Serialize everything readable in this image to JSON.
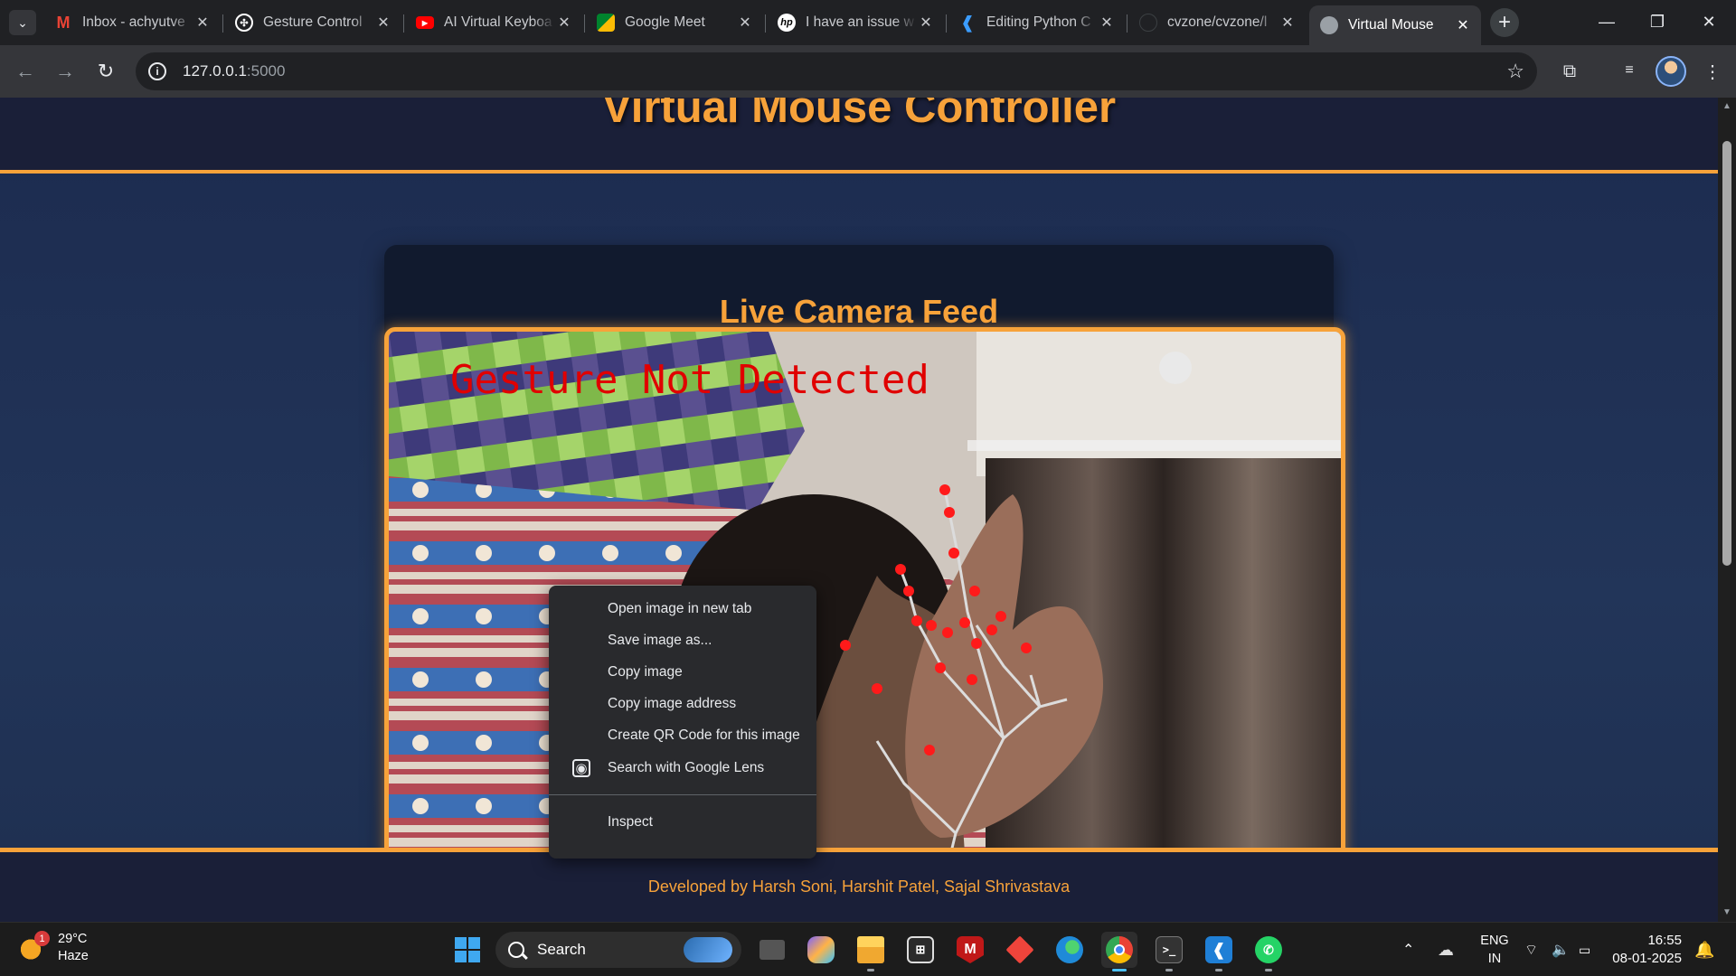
{
  "browser": {
    "tabs": [
      {
        "label": "Inbox - achyutve",
        "icon": "gmail-icon",
        "color": "#ea4335"
      },
      {
        "label": "Gesture Control",
        "icon": "openai-icon",
        "color": "#ffffff"
      },
      {
        "label": "AI Virtual Keyboa",
        "icon": "youtube-icon",
        "color": "#ff0000"
      },
      {
        "label": "Google Meet",
        "icon": "google-meet-icon",
        "color": "#00832d"
      },
      {
        "label": "I have an issue w",
        "icon": "hp-icon",
        "color": "#ffffff"
      },
      {
        "label": "Editing Python C",
        "icon": "vscode-icon",
        "color": "#3b9cff"
      },
      {
        "label": "cvzone/cvzone/l",
        "icon": "github-icon",
        "color": "#202124"
      },
      {
        "label": "Virtual Mouse",
        "icon": "globe-icon",
        "color": "#9aa0a6"
      }
    ],
    "url_host": "127.0.0.1",
    "url_port": ":5000"
  },
  "page": {
    "title": "Virtual Mouse Controller",
    "feed_heading": "Live Camera Feed",
    "overlay_text": "Gesture Not Detected",
    "footer": "Developed by Harsh Soni, Harshit Patel, Sajal Shrivastava"
  },
  "context_menu": {
    "items": [
      "Open image in new tab",
      "Save image as...",
      "Copy image",
      "Copy image address",
      "Create QR Code for this image"
    ],
    "lens_item": "Search with Google Lens",
    "inspect": "Inspect"
  },
  "taskbar": {
    "weather_temp": "29°C",
    "weather_desc": "Haze",
    "weather_badge": "1",
    "search_placeholder": "Search",
    "lang_line1": "ENG",
    "lang_line2": "IN",
    "time": "16:55",
    "date": "08-01-2025",
    "apps": [
      "task-view-icon",
      "copilot-icon",
      "file-explorer-icon",
      "microsoft-store-icon",
      "mcafee-icon",
      "anydesk-icon",
      "edge-icon",
      "chrome-icon",
      "terminal-icon",
      "vscode-icon",
      "whatsapp-icon"
    ]
  },
  "colors": {
    "accent": "#f7a23a",
    "page_bg": "#1c2b4f",
    "overlay_red": "#e00000"
  }
}
